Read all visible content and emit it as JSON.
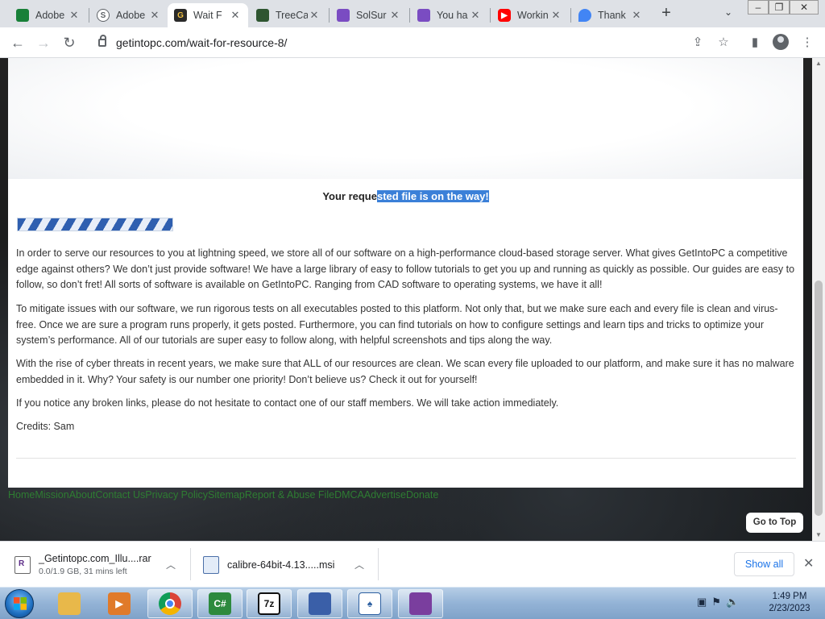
{
  "browser": {
    "tabs": [
      {
        "title": "Adobe",
        "favicon": "sheets-icon",
        "color": "#188038",
        "glyph": ""
      },
      {
        "title": "Adobe",
        "favicon": "s-circle-icon",
        "color": "#5f6368",
        "glyph": "S"
      },
      {
        "title": "Wait F",
        "favicon": "g-logo-icon",
        "color": "#333333",
        "glyph": "G",
        "active": true
      },
      {
        "title": "TreeCa",
        "favicon": "treecard-icon",
        "color": "#2e5530",
        "glyph": ""
      },
      {
        "title": "SolSur",
        "favicon": "solsur-icon",
        "color": "#7a4cc2",
        "glyph": ""
      },
      {
        "title": "You ha",
        "favicon": "youha-icon",
        "color": "#7a4cc2",
        "glyph": ""
      },
      {
        "title": "Workin",
        "favicon": "youtube-icon",
        "color": "#ff0000",
        "glyph": ""
      },
      {
        "title": "Thank",
        "favicon": "drop-icon",
        "color": "#4285f4",
        "glyph": ""
      }
    ],
    "new_tab": "+",
    "tab_search": "⌄",
    "window_controls": {
      "minimize": "–",
      "restore": "❐",
      "close": "✕"
    },
    "url_domain": "getintopc.com",
    "url_path": "/wait-for-resource-8/",
    "nav": {
      "back": "←",
      "forward": "→",
      "reload": "↻"
    },
    "toolbar_icons": {
      "share": "⇪",
      "bookmark": "☆",
      "sidepanel": "▮",
      "menu": "⋮"
    }
  },
  "page": {
    "title_unselected": "Your reque",
    "title_selected": "sted file is on the way!",
    "progress_state": "indeterminate",
    "paragraphs": [
      "In order to serve our resources to you at lightning speed, we store all of our software on a high-performance cloud-based storage server. What gives GetIntoPC a competitive edge against others? We don’t just provide software! We have a large library of easy to follow tutorials to get you up and running as quickly as possible. Our guides are easy to follow, so don’t fret! All sorts of software is available on GetIntoPC. Ranging from CAD software to operating systems, we have it all!",
      "To mitigate issues with our software, we run rigorous tests on all executables posted to this platform. Not only that, but we make sure each and every file is clean and virus-free. Once we are sure a program runs properly, it gets posted. Furthermore, you can find tutorials on how to configure settings and learn tips and tricks to optimize your system’s performance. All of our tutorials are super easy to follow along, with helpful screenshots and tips along the way.",
      "With the rise of cyber threats in recent years, we make sure that ALL of our resources are clean. We scan every file uploaded to our platform, and make sure it has no malware embedded in it. Why? Your safety is our number one priority! Don’t believe us? Check it out for yourself!",
      "If you notice any broken links, please do not hesitate to contact one of our staff members. We will take action immediately.",
      "Credits: Sam"
    ],
    "footer_links": [
      "Home",
      "Mission",
      "About",
      "Contact Us",
      "Privacy Policy",
      "Sitemap",
      "Report & Abuse File",
      "DMCA",
      "Advertise",
      "Donate"
    ],
    "go_to_top": "Go to Top",
    "link_color": "#2e7d32"
  },
  "downloads": {
    "items": [
      {
        "name": "_Getintopc.com_Illu....rar",
        "status": "0.0/1.9 GB, 31 mins left"
      },
      {
        "name": "calibre-64bit-4.13.....msi",
        "status": ""
      }
    ],
    "show_all": "Show all",
    "close": "✕",
    "caret": "︿"
  },
  "taskbar": {
    "apps": [
      {
        "name": "explorer",
        "label": "",
        "color": "#e8b84a"
      },
      {
        "name": "media-player",
        "label": "▶",
        "color": "#e07a2a"
      },
      {
        "name": "chrome",
        "label": "",
        "color": "#4285f4"
      },
      {
        "name": "csharp",
        "label": "C#",
        "color": "#2d8a3e"
      },
      {
        "name": "7zip",
        "label": "7z",
        "color": "#111111"
      },
      {
        "name": "setup",
        "label": "",
        "color": "#3a5fa8"
      },
      {
        "name": "solitaire",
        "label": "♠",
        "color": "#2c5fa0"
      },
      {
        "name": "winrar",
        "label": "",
        "color": "#7a3e9e"
      }
    ],
    "tray_icons": [
      "▣",
      "⚑",
      "🔈"
    ],
    "time": "1:49 PM",
    "date": "2/23/2023"
  }
}
